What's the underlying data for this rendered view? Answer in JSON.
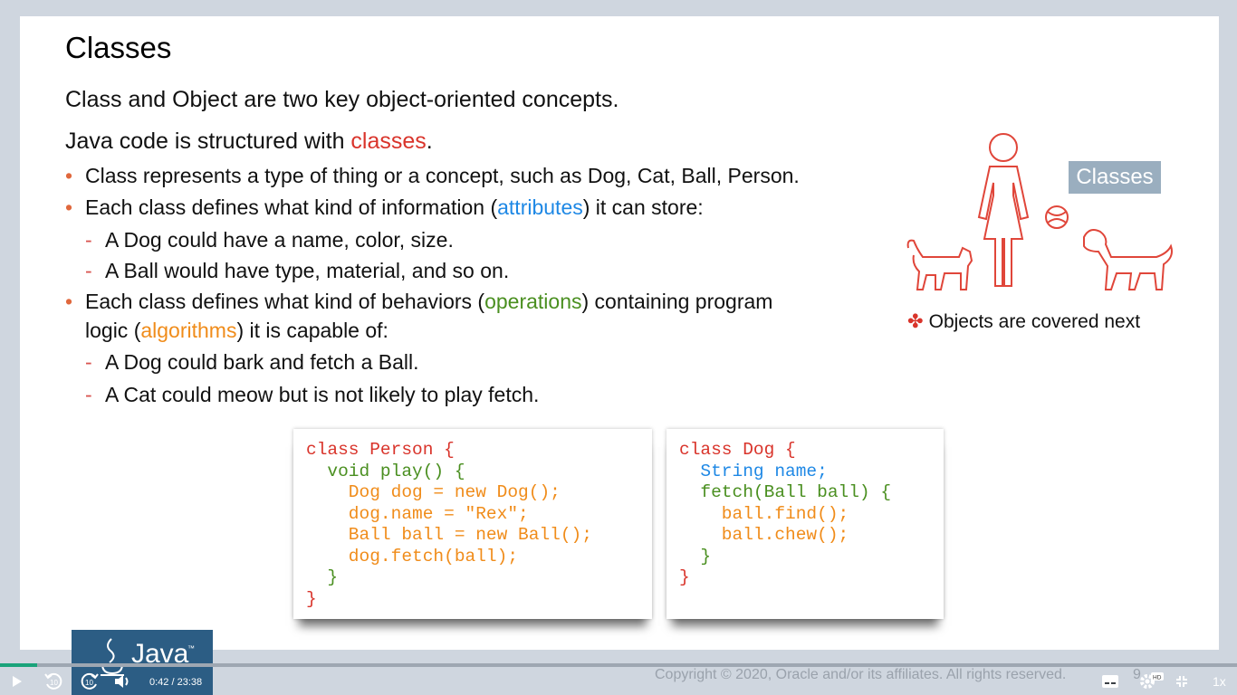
{
  "slide": {
    "title": "Classes",
    "line1": "Class and Object are two key object-oriented concepts.",
    "line2_pre": "Java code is structured with ",
    "line2_highlight": "classes",
    "line2_post": ".",
    "bullet1": "Class represents a type of thing or a concept, such as Dog, Cat, Ball, Person.",
    "bullet2_pre": "Each class defines what kind of information (",
    "bullet2_highlight": "attributes",
    "bullet2_post": ") it can store:",
    "sub1": "A Dog could have a name, color, size.",
    "sub2": "A Ball would have type, material, and so on.",
    "bullet3_pre": "Each class defines what kind of behaviors (",
    "bullet3_highlight": "operations",
    "bullet3_post": ") containing program",
    "bullet3_line2_pre": "logic (",
    "bullet3_line2_highlight": "algorithms",
    "bullet3_line2_post": ") it is capable of:",
    "sub3": "A Dog could bark and fetch a Ball.",
    "sub4": "A Cat could meow but is not likely to play fetch.",
    "bullet_mark": "•",
    "sub_mark": "-"
  },
  "code_person": {
    "l1": "class Person {",
    "l2": "  void play() {",
    "l3": "    Dog dog = new Dog();",
    "l4": "    dog.name = \"Rex\";",
    "l5": "    Ball ball = new Ball();",
    "l6": "    dog.fetch(ball);",
    "l7": "  }",
    "l8": "}"
  },
  "code_dog": {
    "l1": "class Dog {",
    "l2": "  String name;",
    "l3": "  fetch(Ball ball) {",
    "l4": "    ball.find();",
    "l5": "    ball.chew();",
    "l6": "  }",
    "l7": "}"
  },
  "illustration": {
    "badge": "Classes",
    "note_star": "✤",
    "note": "Objects are covered next"
  },
  "footer": {
    "logo": "Java",
    "logo_tm": "™",
    "copyright": "Copyright © 2020, Oracle and/or its affiliates. All rights reserved.",
    "page": "9"
  },
  "player": {
    "current_time": "0:42",
    "separator": "/",
    "total_time": "23:38",
    "progress_fraction": 0.03,
    "speed": "1x",
    "rewind_label": "10",
    "forward_label": "10",
    "hd_badge": "HD",
    "accent_color": "#1aa37a"
  }
}
